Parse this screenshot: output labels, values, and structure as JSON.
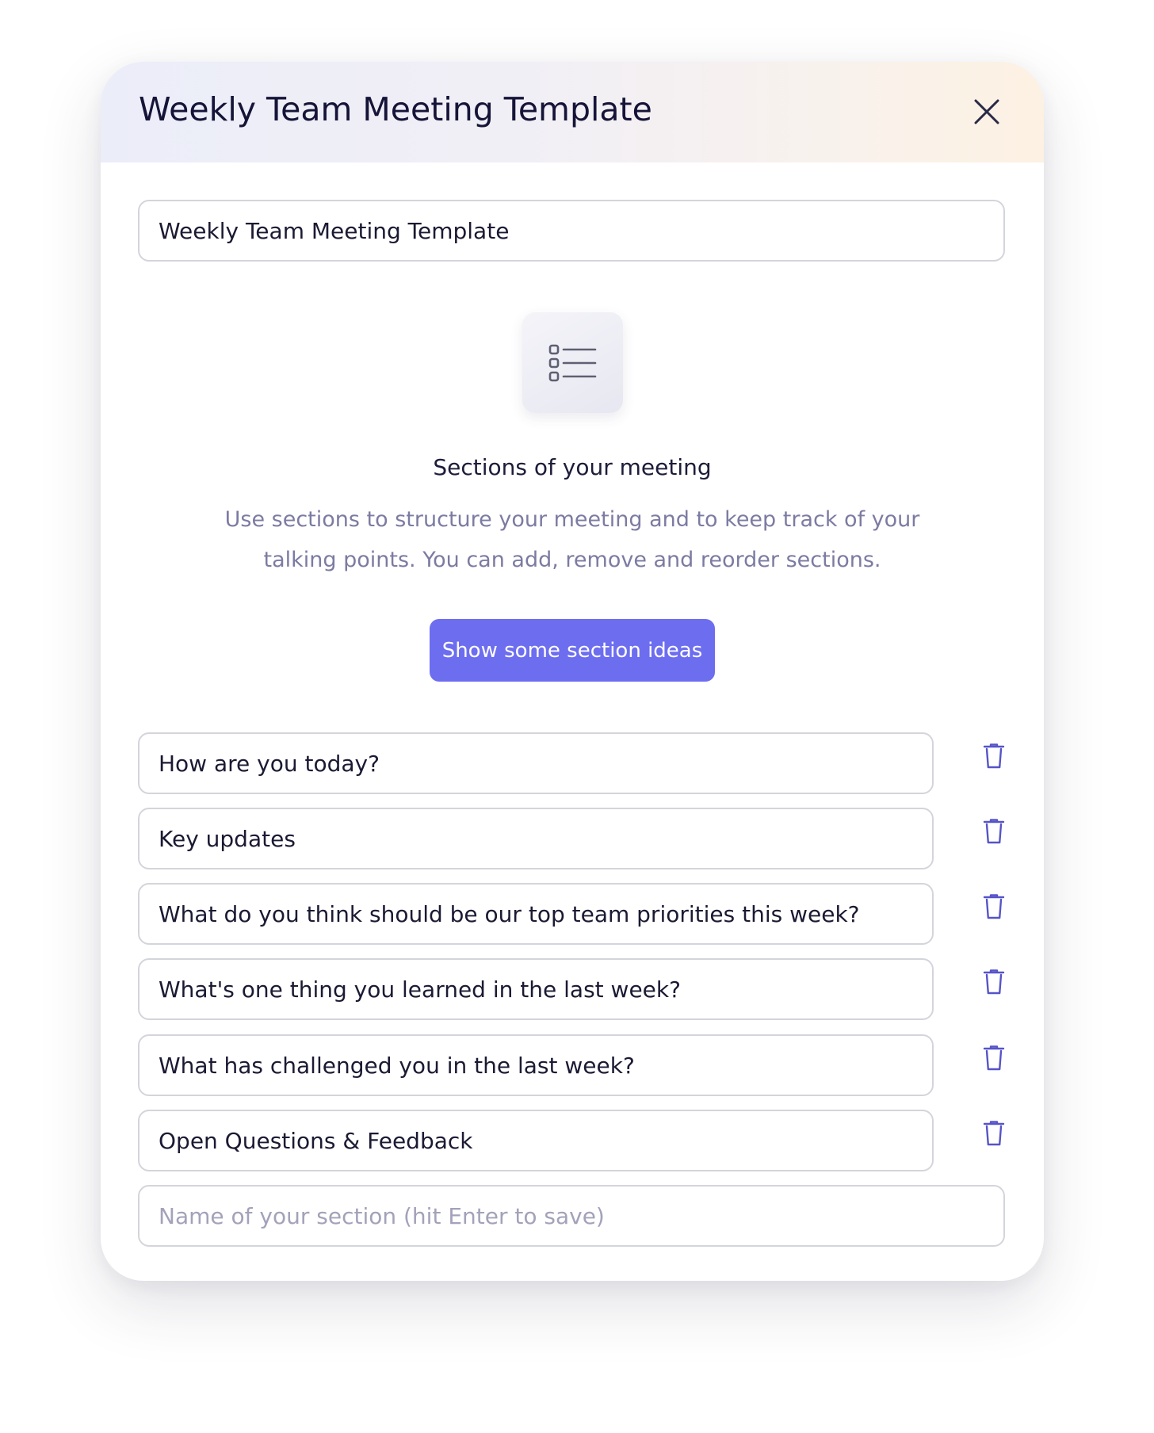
{
  "modal": {
    "title": "Weekly Team Meeting Template",
    "close_icon": "close-icon"
  },
  "template_name": {
    "value": "Weekly Team Meeting Template"
  },
  "sections_info": {
    "icon": "list-icon",
    "heading": "Sections of your meeting",
    "description": "Use sections to structure your meeting and to keep track of your talking points. You can add, remove and reorder sections.",
    "ideas_button_label": "Show some section ideas"
  },
  "sections": [
    {
      "name": "How are you today?",
      "delete_icon": "trash-icon"
    },
    {
      "name": "Key updates",
      "delete_icon": "trash-icon"
    },
    {
      "name": "What do you think should be our top team priorities this week?",
      "delete_icon": "trash-icon"
    },
    {
      "name": "What's one thing you learned in the last week?",
      "delete_icon": "trash-icon"
    },
    {
      "name": "What has challenged you in the last week?",
      "delete_icon": "trash-icon"
    },
    {
      "name": "Open Questions & Feedback",
      "delete_icon": "trash-icon"
    }
  ],
  "new_section": {
    "value": "",
    "placeholder": "Name of your section (hit Enter to save)"
  },
  "colors": {
    "accent": "#6d6df0",
    "title_text": "#151438",
    "muted_text": "#7c7ba2",
    "icon_stroke": "#5654c8",
    "border": "#d4d4dc"
  }
}
